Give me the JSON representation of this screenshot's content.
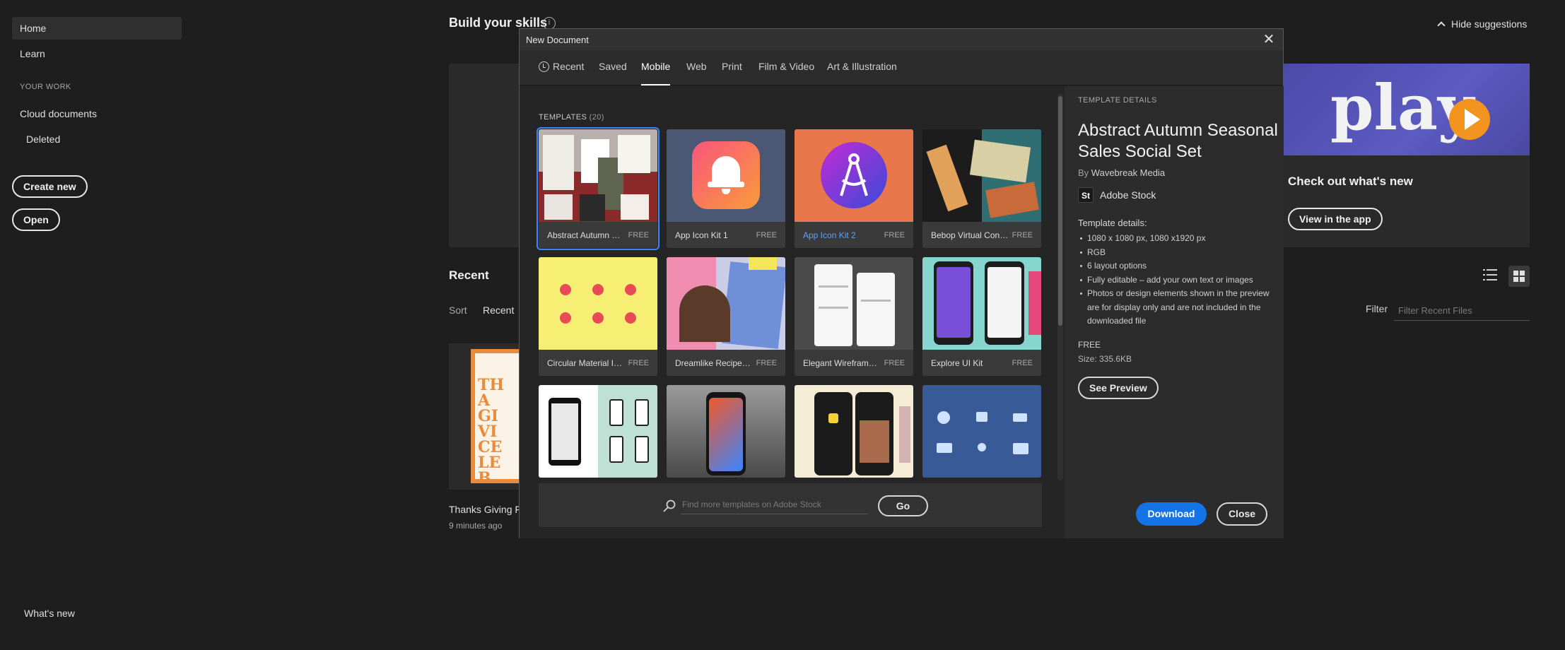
{
  "sidebar": {
    "home": "Home",
    "learn": "Learn",
    "section": "YOUR WORK",
    "cloud": "Cloud documents",
    "deleted": "Deleted",
    "create": "Create new",
    "open": "Open",
    "whats_new": "What's new"
  },
  "home": {
    "title": "Build your skills",
    "info_glyph": "i",
    "hide": "Hide suggestions",
    "promo_word": "play",
    "promo_title": "Check out what's new",
    "promo_button": "View in the app",
    "recent_title": "Recent",
    "sort_label": "Sort",
    "sort_value": "Recent",
    "filter_label": "Filter",
    "filter_placeholder": "Filter Recent Files",
    "thumb_text": "THA GIVI CELEB",
    "file_name": "Thanks Giving Fly",
    "file_time": "9 minutes ago"
  },
  "dialog": {
    "title": "New Document",
    "close_glyph": "✕",
    "tabs": [
      "Recent",
      "Saved",
      "Mobile",
      "Web",
      "Print",
      "Film & Video",
      "Art & Illustration"
    ],
    "active_tab": "Mobile",
    "templates_label": "TEMPLATES",
    "templates_count": "(20)",
    "templates": [
      {
        "name": "Abstract Autumn Se...",
        "badge": "FREE"
      },
      {
        "name": "App Icon Kit 1",
        "badge": "FREE"
      },
      {
        "name": "App Icon Kit 2",
        "badge": "FREE"
      },
      {
        "name": "Bebop Virtual Conce...",
        "badge": "FREE"
      },
      {
        "name": "Circular Material Ico...",
        "badge": "FREE"
      },
      {
        "name": "Dreamlike Recipe So...",
        "badge": "FREE"
      },
      {
        "name": "Elegant Wireframe Kit",
        "badge": "FREE"
      },
      {
        "name": "Explore UI Kit",
        "badge": "FREE"
      }
    ],
    "search_placeholder": "Find more templates on Adobe Stock",
    "go": "Go"
  },
  "details": {
    "head": "TEMPLATE DETAILS",
    "title": "Abstract Autumn Seasonal Sales Social Set",
    "by_label": "By",
    "author": "Wavebreak Media",
    "stock_badge": "St",
    "stock_name": "Adobe Stock",
    "sub": "Template details:",
    "items": [
      "1080 x 1080 px, 1080 x1920 px",
      "RGB",
      "6 layout options",
      "Fully editable – add your own text or images",
      "Photos or design elements shown in the preview are for display only and are not included in the downloaded file"
    ],
    "price": "FREE",
    "size": "Size:  335.6KB",
    "preview": "See Preview",
    "download": "Download",
    "close": "Close"
  },
  "colors": {
    "accent": "#1473e6",
    "selection": "#3a86ff",
    "link": "#5aa2ff"
  }
}
